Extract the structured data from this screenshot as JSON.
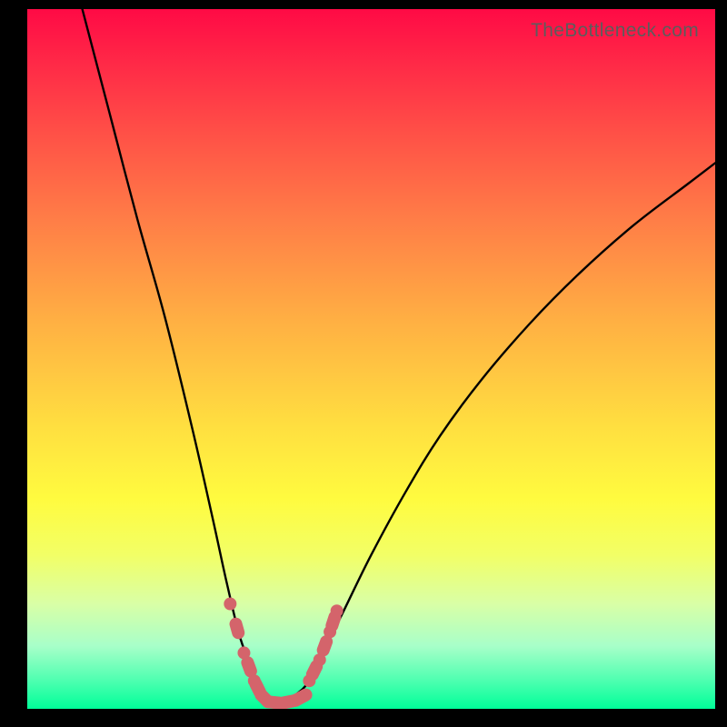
{
  "watermark": "TheBottleneck.com",
  "chart_data": {
    "type": "line",
    "title": "",
    "xlabel": "",
    "ylabel": "",
    "xlim": [
      0,
      100
    ],
    "ylim": [
      0,
      100
    ],
    "series": [
      {
        "name": "bottleneck-curve",
        "x": [
          8,
          12,
          16,
          20,
          24,
          27,
          29,
          31,
          33,
          34,
          35.5,
          37,
          39,
          41,
          43,
          46,
          50,
          55,
          60,
          66,
          73,
          80,
          88,
          96,
          100
        ],
        "y": [
          100,
          85,
          70,
          56,
          40,
          27,
          18,
          10,
          5,
          2,
          1,
          1,
          2,
          4,
          8,
          14,
          22,
          31,
          39,
          47,
          55,
          62,
          69,
          75,
          78
        ]
      },
      {
        "name": "highlight-band-left",
        "x": [
          29.5,
          31.5,
          33,
          34,
          35
        ],
        "y": [
          15,
          8,
          4,
          2,
          1
        ]
      },
      {
        "name": "highlight-band-right",
        "x": [
          41,
          42.5,
          44,
          45
        ],
        "y": [
          4,
          7,
          11,
          14
        ]
      },
      {
        "name": "highlight-band-bottom",
        "x": [
          35,
          37,
          39,
          40.5
        ],
        "y": [
          1,
          0.8,
          1.2,
          2
        ]
      }
    ],
    "colors": {
      "curve": "#000000",
      "highlight": "#d4646b"
    }
  }
}
